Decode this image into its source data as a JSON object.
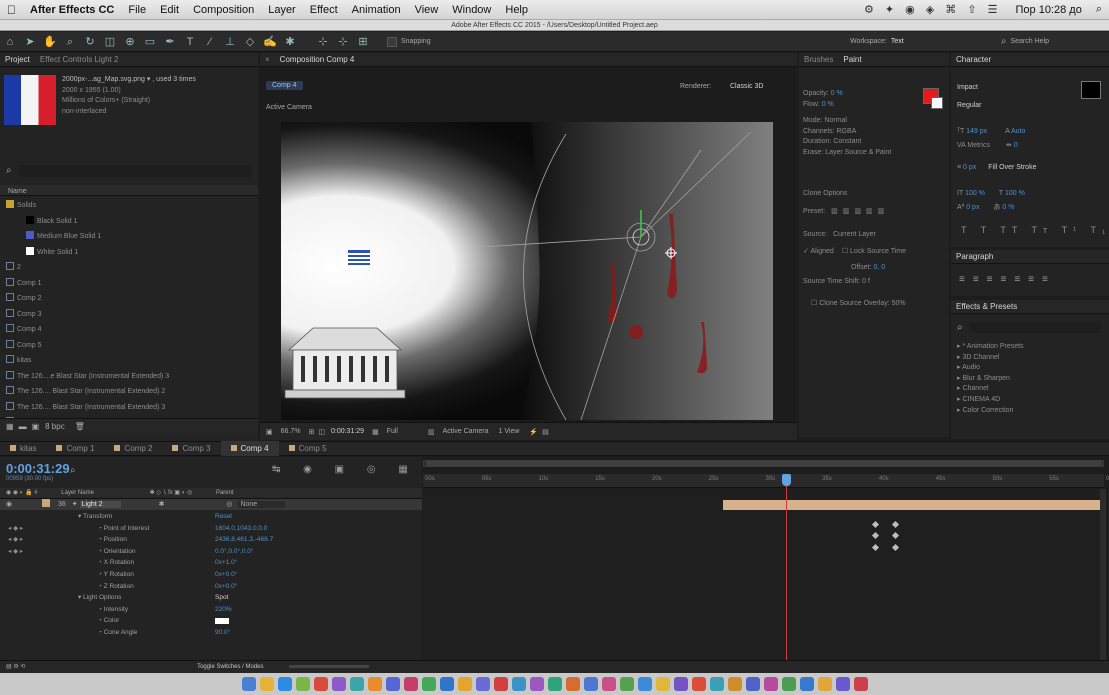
{
  "menubar": {
    "app": "After Effects CC",
    "items": [
      "File",
      "Edit",
      "Composition",
      "Layer",
      "Effect",
      "Animation",
      "View",
      "Window",
      "Help"
    ],
    "clock": "Пор 10:28 до"
  },
  "window_title": "Adobe After Effects CC 2015 - /Users/Desktop/Untitled Project.aep",
  "toolbar": {
    "snapping": "Snapping",
    "workspace_label": "Workspace:",
    "workspace_value": "Text",
    "search_placeholder": "Search Help"
  },
  "project_panel": {
    "tab": "Project",
    "effect_controls_tab": "Effect Controls Light 2",
    "asset_info": [
      "2000px-...ag_Map.svg.png ▾ , used 3 times",
      "2000 x 1955 (1.00)",
      "Millions of Colors+ (Straight)",
      "non-interlaced"
    ],
    "column_name": "Name",
    "items": [
      {
        "name": "Solids",
        "type": "folder",
        "color": "#c9a234"
      },
      {
        "name": "Black Solid 1",
        "type": "solid",
        "color": "#000000"
      },
      {
        "name": "Medium Blue Solid 1",
        "type": "solid",
        "color": "#4d5bc7"
      },
      {
        "name": "White Solid 1",
        "type": "solid",
        "color": "#ffffff"
      },
      {
        "name": "2",
        "type": "comp",
        "color": "#3e4f74"
      },
      {
        "name": "Comp 1",
        "type": "comp",
        "color": "#3e4f74"
      },
      {
        "name": "Comp 2",
        "type": "comp",
        "color": "#3e4f74"
      },
      {
        "name": "Comp 3",
        "type": "comp",
        "color": "#3e4f74"
      },
      {
        "name": "Comp 4",
        "type": "comp",
        "color": "#3e4f74"
      },
      {
        "name": "Comp 5",
        "type": "comp",
        "color": "#3e4f74"
      },
      {
        "name": "kitas",
        "type": "comp",
        "color": "#3e4f74"
      },
      {
        "name": "The 126....e Blast Star (Instrumental Extended) 3",
        "type": "audio",
        "color": "#3e4f74"
      },
      {
        "name": "The 126.... Blast Star (Instrumental Extended) 2",
        "type": "audio",
        "color": "#3e4f74"
      },
      {
        "name": "The 126.... Blast Star (Instrumental Extended) 3",
        "type": "audio",
        "color": "#3e4f74"
      },
      {
        "name": "The 126.... Blast Star (Instrumental Extended) 4",
        "type": "audio",
        "color": "#3e4f74"
      }
    ],
    "footer_bpc": "8 bpc"
  },
  "composition_panel": {
    "tab": "Composition Comp 4",
    "comp_button": "Comp 4",
    "renderer_label": "Renderer:",
    "renderer_value": "Classic 3D",
    "active_camera": "Active Camera",
    "footer": {
      "zoom": "66.7%",
      "timecode": "0:00:31:29",
      "quality": "Full",
      "view": "Active Camera",
      "views": "1 View"
    }
  },
  "paint_panel": {
    "tabs": [
      "Brushes",
      "Paint"
    ],
    "fields": [
      {
        "label": "Opacity:",
        "value": "0 %"
      },
      {
        "label": "Flow:",
        "value": "0 %"
      },
      {
        "label": "Mode:",
        "value": "Normal"
      },
      {
        "label": "Channels:",
        "value": "RGBA"
      },
      {
        "label": "Duration:",
        "value": "Constant"
      },
      {
        "label": "Erase:",
        "value": "Layer Source & Paint"
      }
    ],
    "clone_options": "Clone Options",
    "preset_label": "Preset:",
    "source_label": "Source:",
    "source_value": "Current Layer",
    "aligned": "Aligned",
    "lock_source_time": "Lock Source Time",
    "offset_label": "Offset:",
    "offset_value": "0, 0",
    "source_time_shift": "Source Time Shift: 0 f",
    "clone_overlay": "Clone Source Overlay: 50%"
  },
  "character_panel": {
    "tab": "Character",
    "font": "Impact",
    "style": "Regular",
    "size": "149 px",
    "leading": "Auto",
    "kerning": "Metrics",
    "tracking": "0",
    "stroke_width": "0 px",
    "stroke_mode": "Fill Over Stroke",
    "vert_scale": "100 %",
    "horiz_scale": "100 %",
    "baseline": "0 px",
    "tsume": "0 %",
    "paragraph_tab": "Paragraph"
  },
  "effects_panel": {
    "tab": "Effects & Presets",
    "search_placeholder": "",
    "items": [
      "* Animation Presets",
      "3D Channel",
      "Audio",
      "Blur & Sharpen",
      "Channel",
      "CINEMA 4D",
      "Color Correction"
    ]
  },
  "timeline": {
    "tabs": [
      "kitas",
      "Comp 1",
      "Comp 2",
      "Comp 3",
      "Comp 4",
      "Comp 5"
    ],
    "active_tab": "Comp 4",
    "timecode": "0:00:31:29",
    "frame_info": "00959 (30.00 fps)",
    "columns": {
      "source": "Layer Name",
      "parent": "Parent"
    },
    "ruler": [
      "00s",
      "05s",
      "10s",
      "15s",
      "20s",
      "25s",
      "30s",
      "35s",
      "40s",
      "45s",
      "50s",
      "55s",
      "01:00s"
    ],
    "playhead_time_s": 32,
    "layer": {
      "index": "36",
      "name": "Light 2",
      "parent": "None"
    },
    "properties": [
      {
        "name": "Transform",
        "value": "Reset",
        "indent": 1
      },
      {
        "name": "Point of Interest",
        "value": "1604.0,1043.0,0.0",
        "indent": 2
      },
      {
        "name": "Position",
        "value": "2436.8,461.3,-468.7",
        "indent": 2
      },
      {
        "name": "Orientation",
        "value": "0.0°,0.0°,0.0°",
        "indent": 2
      },
      {
        "name": "X Rotation",
        "value": "0x+1.0°",
        "indent": 2
      },
      {
        "name": "Y Rotation",
        "value": "0x+0.0°",
        "indent": 2
      },
      {
        "name": "Z Rotation",
        "value": "0x+0.0°",
        "indent": 2
      },
      {
        "name": "Light Options",
        "value": "Spot",
        "indent": 1
      },
      {
        "name": "Intensity",
        "value": "220%",
        "indent": 2
      },
      {
        "name": "Color",
        "value": "",
        "indent": 2
      },
      {
        "name": "Cone Angle",
        "value": "90.0°",
        "indent": 2
      }
    ],
    "toggle_label": "Toggle Switches / Modes"
  },
  "colors": {
    "accent": "#4f91c9",
    "layer_bar": "#d9b08c",
    "playhead": "#d23b3b",
    "timecode": "#5fa3e0",
    "swatch": "#e31b1b"
  }
}
